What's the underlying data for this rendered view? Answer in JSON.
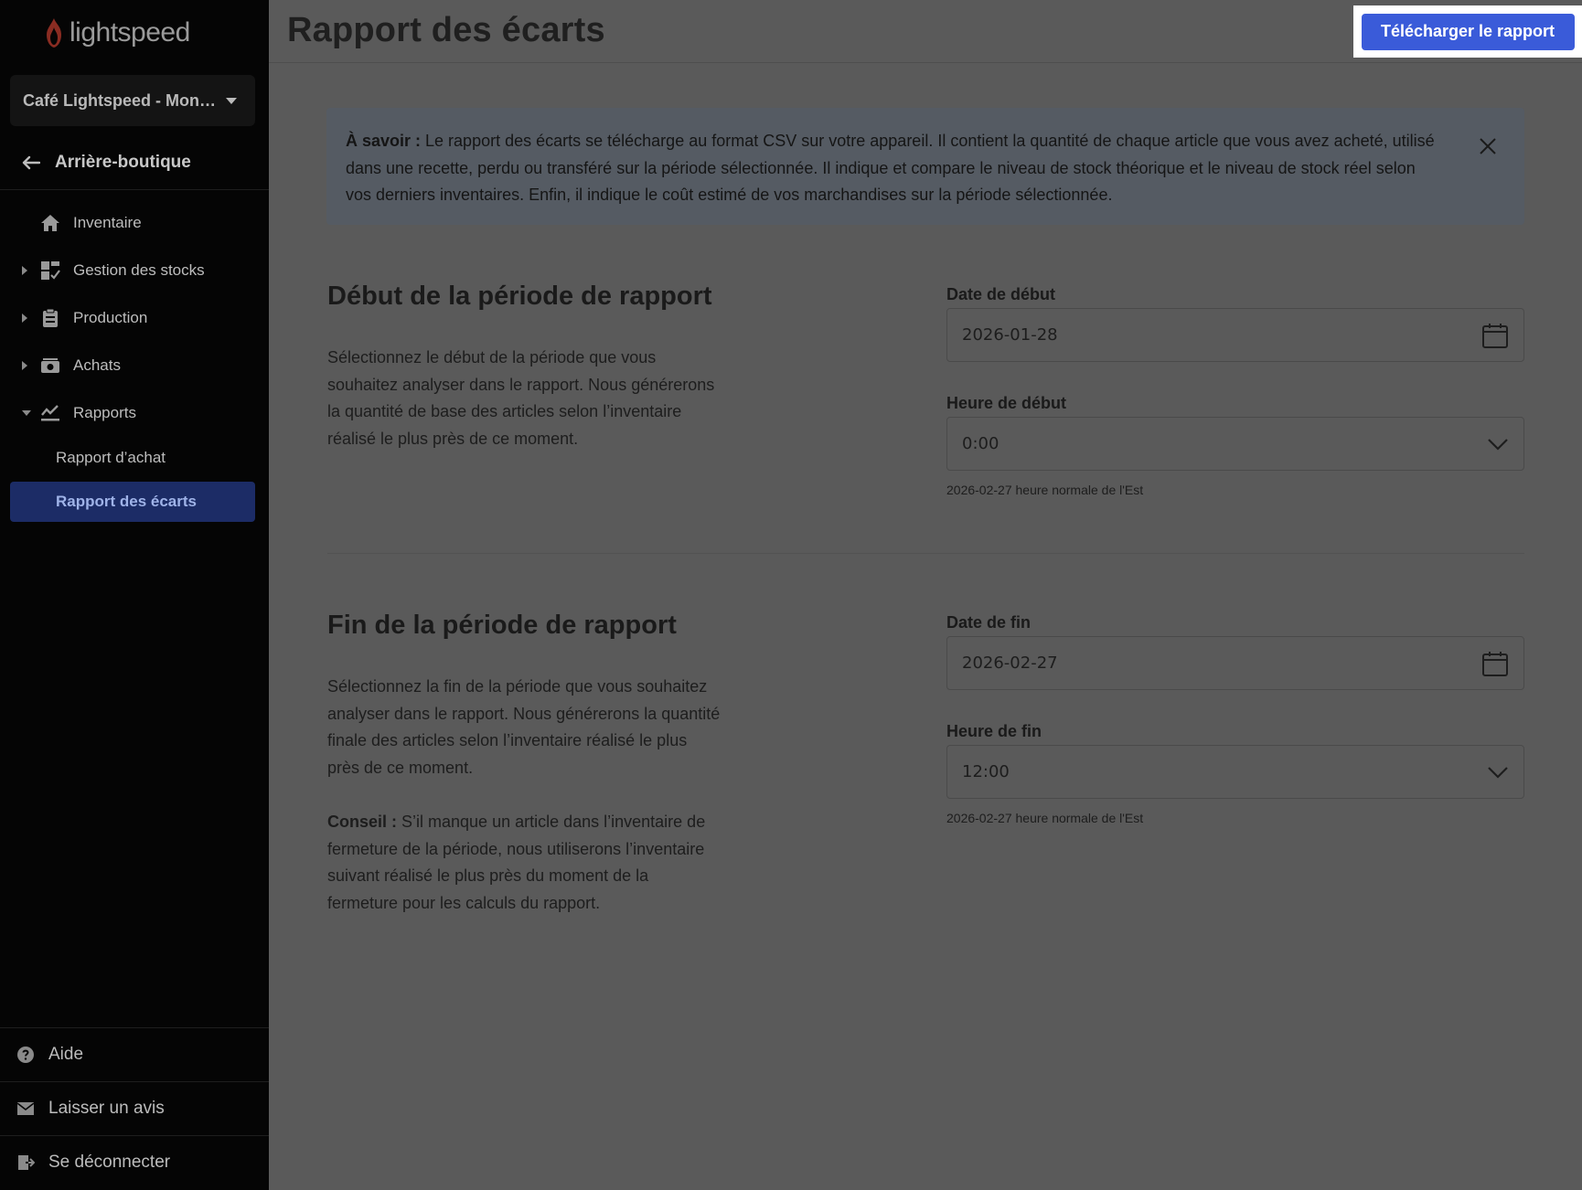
{
  "sidebar": {
    "logo_text": "lightspeed",
    "store_name": "Café Lightspeed - Mon…",
    "back_label": "Arrière-boutique",
    "nav": [
      {
        "label": "Inventaire",
        "icon": "home-icon"
      },
      {
        "label": "Gestion des stocks",
        "icon": "dashboard-icon"
      },
      {
        "label": "Production",
        "icon": "clipboard-icon"
      },
      {
        "label": "Achats",
        "icon": "cash-icon"
      },
      {
        "label": "Rapports",
        "icon": "chart-icon"
      }
    ],
    "sub_items": [
      {
        "label": "Rapport d’achat"
      },
      {
        "label": "Rapport des écarts",
        "active": true
      }
    ],
    "bottom": [
      {
        "label": "Aide",
        "icon": "help-icon"
      },
      {
        "label": "Laisser un avis",
        "icon": "mail-icon"
      },
      {
        "label": "Se déconnecter",
        "icon": "logout-icon"
      }
    ]
  },
  "header": {
    "title": "Rapport des écarts",
    "download_label": "Télécharger le rapport"
  },
  "banner": {
    "bold": "À savoir :",
    "text": " Le rapport des écarts se télécharge au format CSV sur votre appareil. Il contient la quantité de chaque article que vous avez acheté, utilisé dans une recette, perdu ou transféré sur la période sélectionnée. Il indique et compare le niveau de stock théorique et le niveau de stock réel selon vos derniers inventaires. Enfin, il indique le coût estimé de vos marchandises sur la période sélectionnée."
  },
  "start": {
    "title": "Début de la période de rapport",
    "description": "Sélectionnez le début de la période que vous souhaitez analyser dans le rapport. Nous générerons la quantité de base des articles selon l’inventaire réalisé le plus près de ce moment.",
    "date_label": "Date de début",
    "date_value": "2026-01-28",
    "time_label": "Heure de début",
    "time_value": "0:00",
    "helper": "2026-02-27 heure normale de l'Est"
  },
  "end": {
    "title": "Fin de la période de rapport",
    "description": "Sélectionnez la fin de la période que vous souhaitez analyser dans le rapport. Nous générerons la quantité finale des articles selon l’inventaire réalisé le plus près de ce moment.",
    "tip_bold": "Conseil :",
    "tip_text": " S’il manque un article dans l’inventaire de fermeture de la période, nous utiliserons l’inventaire suivant réalisé le plus près du moment de la fermeture pour les calculs du rapport.",
    "date_label": "Date de fin",
    "date_value": "2026-02-27",
    "time_label": "Heure de fin",
    "time_value": "12:00",
    "helper": "2026-02-27 heure normale de l'Est"
  },
  "colors": {
    "accent": "#3a5bd9",
    "sidebar_bg": "#050505",
    "overlay_bg": "#5a5a5a",
    "active_item_bg": "#1c2c66"
  }
}
